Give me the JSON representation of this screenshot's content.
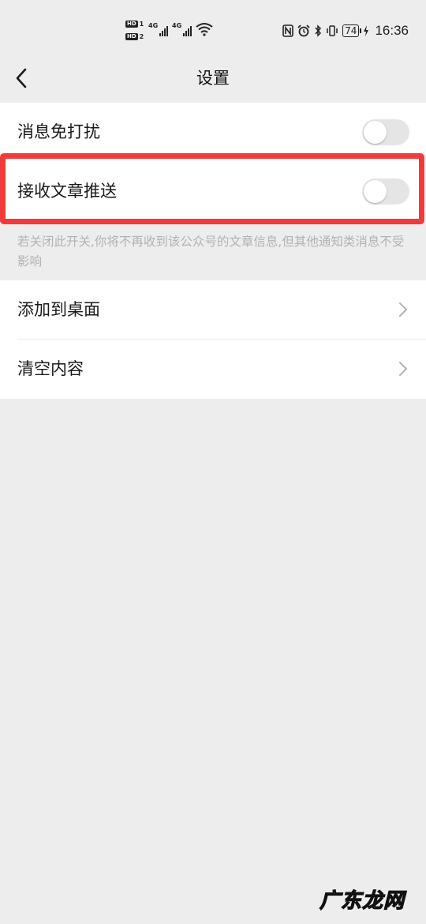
{
  "status_bar": {
    "hd1": "HD",
    "hd1_num": "1",
    "hd2": "HD",
    "hd2_num": "2",
    "net1": "4G",
    "net2": "4G",
    "battery": "74",
    "time": "16:36",
    "icons": [
      "nfc-icon",
      "alarm-icon",
      "bluetooth-icon",
      "vibrate-icon",
      "battery-icon",
      "charging-icon"
    ]
  },
  "navbar": {
    "title": "设置",
    "back_icon": "chevron-left-icon"
  },
  "settings": {
    "do_not_disturb": {
      "label": "消息免打扰",
      "enabled": false
    },
    "receive_articles": {
      "label": "接收文章推送",
      "enabled": false
    },
    "note": "若关闭此开关,你将不再收到该公众号的文章信息,但其他通知类消息不受影响",
    "add_to_desktop": {
      "label": "添加到桌面"
    },
    "clear_content": {
      "label": "清空内容"
    }
  },
  "highlight_color": "#f23a3a",
  "watermark": "广东龙网"
}
